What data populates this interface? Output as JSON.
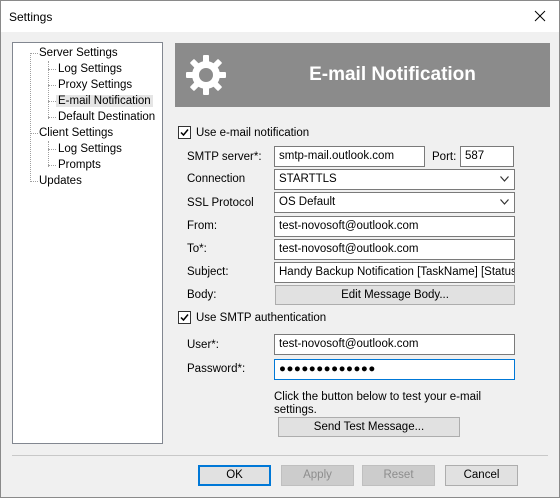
{
  "window": {
    "title": "Settings"
  },
  "tree": {
    "items": [
      {
        "label": "Server Settings"
      },
      {
        "label": "Log Settings"
      },
      {
        "label": "Proxy Settings"
      },
      {
        "label": "E-mail Notification"
      },
      {
        "label": "Default Destination"
      },
      {
        "label": "Client Settings"
      },
      {
        "label": "Log Settings"
      },
      {
        "label": "Prompts"
      },
      {
        "label": "Updates"
      }
    ]
  },
  "header": {
    "title": "E-mail Notification",
    "icon": "gear-icon"
  },
  "form": {
    "use_email_label": "Use e-mail notification",
    "smtp_server_label": "SMTP server*:",
    "smtp_server_value": "smtp-mail.outlook.com",
    "port_label": "Port:",
    "port_value": "587",
    "connection_label": "Connection",
    "connection_value": "STARTTLS",
    "ssl_label": "SSL Protocol",
    "ssl_value": "OS Default",
    "from_label": "From:",
    "from_value": "test-novosoft@outlook.com",
    "to_label": "To*:",
    "to_value": "test-novosoft@outlook.com",
    "subject_label": "Subject:",
    "subject_value": "Handy Backup Notification [TaskName] [Status",
    "body_label": "Body:",
    "edit_body_button": "Edit Message Body...",
    "use_smtp_auth_label": "Use SMTP authentication",
    "user_label": "User*:",
    "user_value": "test-novosoft@outlook.com",
    "password_label": "Password*:",
    "password_value": "●●●●●●●●●●●●●",
    "test_note": "Click the button below to test your e-mail settings.",
    "send_test_button": "Send Test Message..."
  },
  "footer": {
    "ok": "OK",
    "apply": "Apply",
    "reset": "Reset",
    "cancel": "Cancel"
  },
  "colors": {
    "banner": "#8b8b8b",
    "focus_accent": "#0078d7",
    "selected_item": "#e5e5e5"
  }
}
